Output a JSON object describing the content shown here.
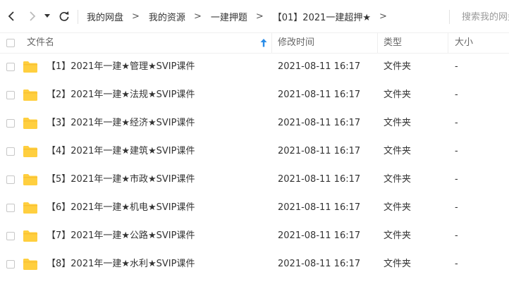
{
  "toolbar": {
    "breadcrumb": [
      "我的网盘",
      "我的资源",
      "一建押题",
      "【01】2021一建超押★"
    ],
    "separator": ">",
    "search_placeholder": "搜索我的网盘文件"
  },
  "header": {
    "name": "文件名",
    "modified": "修改时间",
    "type": "类型",
    "size": "大小",
    "sorted_column": "name",
    "sort_direction": "ascending"
  },
  "files": [
    {
      "name": "【1】2021年一建★管理★SVIP课件",
      "modified": "2021-08-11 16:17",
      "type": "文件夹",
      "size": "-",
      "icon": "folder-icon"
    },
    {
      "name": "【2】2021年一建★法规★SVIP课件",
      "modified": "2021-08-11 16:17",
      "type": "文件夹",
      "size": "-",
      "icon": "folder-icon"
    },
    {
      "name": "【3】2021年一建★经济★SVIP课件",
      "modified": "2021-08-11 16:17",
      "type": "文件夹",
      "size": "-",
      "icon": "folder-icon"
    },
    {
      "name": "【4】2021年一建★建筑★SVIP课件",
      "modified": "2021-08-11 16:17",
      "type": "文件夹",
      "size": "-",
      "icon": "folder-icon"
    },
    {
      "name": "【5】2021年一建★市政★SVIP课件",
      "modified": "2021-08-11 16:17",
      "type": "文件夹",
      "size": "-",
      "icon": "folder-icon"
    },
    {
      "name": "【6】2021年一建★机电★SVIP课件",
      "modified": "2021-08-11 16:17",
      "type": "文件夹",
      "size": "-",
      "icon": "folder-icon"
    },
    {
      "name": "【7】2021年一建★公路★SVIP课件",
      "modified": "2021-08-11 16:17",
      "type": "文件夹",
      "size": "-",
      "icon": "folder-icon"
    },
    {
      "name": "【8】2021年一建★水利★SVIP课件",
      "modified": "2021-08-11 16:17",
      "type": "文件夹",
      "size": "-",
      "icon": "folder-icon"
    }
  ],
  "colors": {
    "folder": "#ffcf3f",
    "accent": "#2b8de8"
  }
}
